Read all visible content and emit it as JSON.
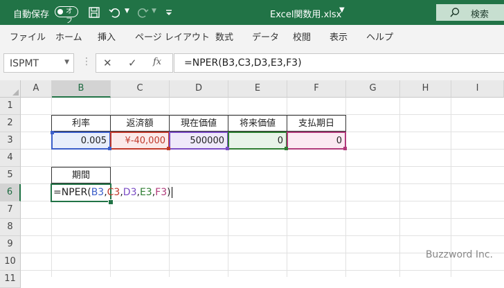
{
  "titlebar": {
    "autosave_label": "自動保存",
    "autosave_state": "オフ",
    "filename": "Excel関数用.xlsx",
    "search_label": "検索"
  },
  "ribbon_tabs": [
    "ファイル",
    "ホーム",
    "挿入",
    "ページ レイアウト",
    "数式",
    "データ",
    "校閲",
    "表示",
    "ヘルプ"
  ],
  "formula_bar": {
    "name_box": "ISPMT",
    "formula": "=NPER(B3,C3,D3,E3,F3)"
  },
  "columns": [
    "A",
    "B",
    "C",
    "D",
    "E",
    "F",
    "G",
    "H",
    "I"
  ],
  "rows": [
    "1",
    "2",
    "3",
    "4",
    "5",
    "6",
    "7",
    "8",
    "9",
    "10",
    "11"
  ],
  "sheet": {
    "headers": [
      "利率",
      "返済額",
      "現在価値",
      "将来価値",
      "支払期日"
    ],
    "values": [
      "0.005",
      "¥-40,000",
      "500000",
      "0",
      "0"
    ],
    "period_label": "期間",
    "edit": {
      "prefix": "=NPER(",
      "args": [
        "B3",
        "C3",
        "D3",
        "E3",
        "F3"
      ],
      "commas": [
        ",",
        ",",
        ",",
        ","
      ],
      "suffix": ")"
    }
  },
  "colors": {
    "accent": "#217346",
    "ref_b3": "#3b5ec9",
    "ref_c3": "#c0392b",
    "ref_d3": "#7a4bc4",
    "ref_e3": "#2e7d32",
    "ref_f3": "#b03a7a"
  },
  "watermark": "Buzzword Inc."
}
